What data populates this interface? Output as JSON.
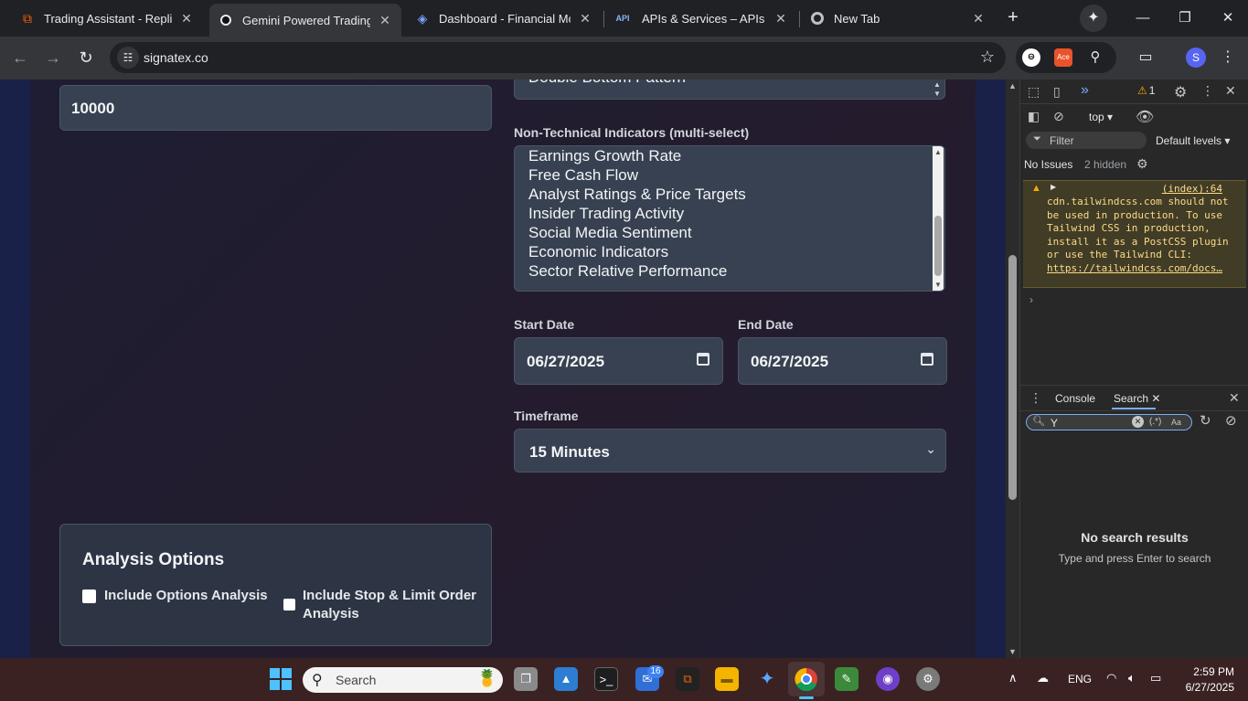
{
  "tabs": [
    {
      "title": "Trading Assistant - Replit",
      "active": false
    },
    {
      "title": "Gemini Powered Trading As",
      "active": true
    },
    {
      "title": "Dashboard - Financial Mod",
      "active": false
    },
    {
      "title": "APIs & Services – APIs & Se",
      "active": false
    },
    {
      "title": "New Tab",
      "active": false
    }
  ],
  "api_favicon": "API",
  "toolbar": {
    "url": "signatex.co",
    "avatar_letter": "S",
    "ext_label": "Ace"
  },
  "form": {
    "amount_value": "10000",
    "pattern_partial": "Double Bottom Pattern",
    "non_tech_label": "Non-Technical Indicators (multi-select)",
    "non_tech_items": [
      "Earnings Growth Rate",
      "Free Cash Flow",
      "Analyst Ratings & Price Targets",
      "Insider Trading Activity",
      "Social Media Sentiment",
      "Economic Indicators",
      "Sector Relative Performance"
    ],
    "start_date_label": "Start Date",
    "start_date_value": "06/27/2025",
    "end_date_label": "End Date",
    "end_date_value": "06/27/2025",
    "timeframe_label": "Timeframe",
    "timeframe_value": "15 Minutes"
  },
  "options": {
    "heading": "Analysis Options",
    "opt1": "Include Options Analysis",
    "opt2_line1": "Include Stop & Limit Order",
    "opt2_line2": "Analysis"
  },
  "devtools": {
    "issue_count": "1",
    "context": "top",
    "filter_placeholder": "Filter",
    "levels": "Default levels",
    "no_issues": "No Issues",
    "hidden": "2 hidden",
    "warn_source": "(index):64",
    "warn_text": "cdn.tailwindcss.com should not be used in production. To use Tailwind CSS in production, install it as a PostCSS plugin or use the Tailwind CLI:",
    "warn_link": "https://tailwindcss.com/docs…",
    "tab_console": "Console",
    "tab_search": "Search",
    "search_value": "Y",
    "regex_label": "(.*)",
    "case_label": "Aa",
    "no_results": "No search results",
    "no_results_hint": "Type and press Enter to search"
  },
  "taskbar": {
    "search_placeholder": "Search",
    "badge": "16",
    "lang": "ENG",
    "time": "2:59 PM",
    "date": "6/27/2025"
  }
}
